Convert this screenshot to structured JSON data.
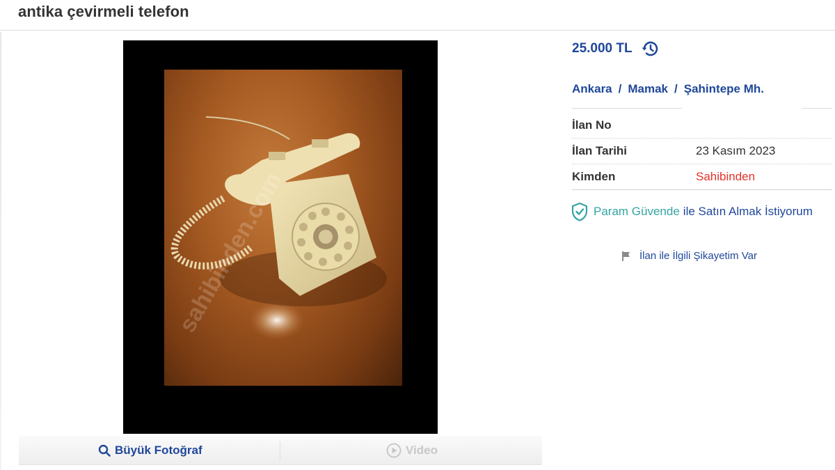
{
  "listing": {
    "title": "antika çevirmeli telefon",
    "price": "25.000 TL",
    "location": {
      "city": "Ankara",
      "district": "Mamak",
      "neighborhood": "Şahintepe Mh.",
      "separator": "/"
    },
    "details": [
      {
        "label": "İlan No",
        "value": ""
      },
      {
        "label": "İlan Tarihi",
        "value": "23 Kasım 2023"
      },
      {
        "label": "Kimden",
        "value": "Sahibinden"
      }
    ],
    "secure_pay": {
      "brand": "Param Güvende",
      "text": "ile Satın Almak İstiyorum"
    },
    "complaint": "İlan ile İlgili Şikayetim Var"
  },
  "media": {
    "large_photo_label": "Büyük Fotoğraf",
    "video_label": "Video",
    "watermark": "sahibinden.com"
  },
  "colors": {
    "link_blue": "#1f4799",
    "teal": "#35a4a4",
    "red": "#e4322a"
  },
  "icons": {
    "price_history": "history-icon",
    "secure": "shield-check-icon",
    "complaint": "flag-icon",
    "large_photo": "search-icon",
    "video": "play-circle-icon"
  }
}
